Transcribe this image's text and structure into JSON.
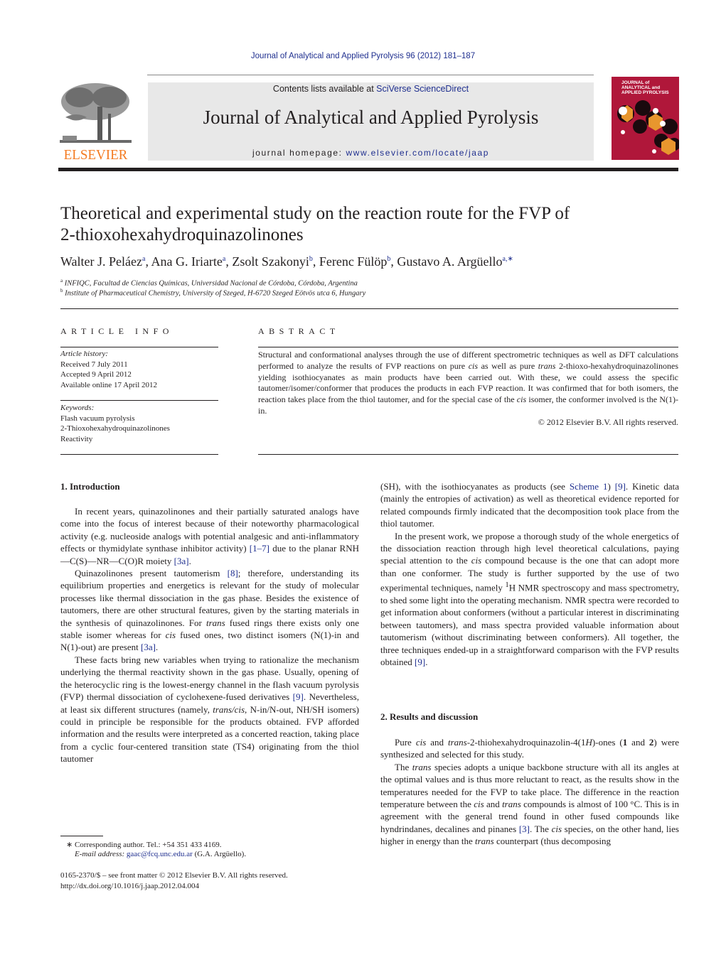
{
  "header": {
    "journal_reference": "Journal of Analytical and Applied Pyrolysis 96 (2012) 181–187",
    "contents_prefix": "Contents lists available at ",
    "contents_link": "SciVerse ScienceDirect",
    "journal_title": "Journal of Analytical and Applied Pyrolysis",
    "homepage_prefix": "journal homepage: ",
    "homepage_link": "www.elsevier.com/locate/jaap",
    "publisher_logo_text": "ELSEVIER",
    "cover_title_lines": [
      "JOURNAL of",
      "ANALYTICAL and",
      "APPLIED PYROLYSIS"
    ],
    "colors": {
      "link": "#1f2f8f",
      "elsevier_orange": "#f47a20",
      "banner_bg": "#e8e8e8",
      "cover_red": "#b0173a",
      "cover_orange": "#e8962e"
    }
  },
  "article": {
    "title_line1": "Theoretical and experimental study on the reaction route for the FVP of",
    "title_line2": "2-thioxohexahydroquinazolinones",
    "authors": [
      {
        "name": "Walter J. Peláez",
        "sup": "a"
      },
      {
        "name": "Ana G. Iriarte",
        "sup": "a"
      },
      {
        "name": "Zsolt Szakonyi",
        "sup": "b"
      },
      {
        "name": "Ferenc Fülöp",
        "sup": "b"
      },
      {
        "name": "Gustavo A. Argüello",
        "sup": "a,∗"
      }
    ],
    "affiliations": [
      {
        "mark": "a",
        "text": "INFIQC, Facultad de Ciencias Químicas, Universidad Nacional de Córdoba, Córdoba, Argentina"
      },
      {
        "mark": "b",
        "text": "Institute of Pharmaceutical Chemistry, University of Szeged, H-6720 Szeged Eötvös utca 6, Hungary"
      }
    ]
  },
  "article_info": {
    "heading": "ARTICLE INFO",
    "history_label": "Article history:",
    "history": [
      "Received 7 July 2011",
      "Accepted 9 April 2012",
      "Available online 17 April 2012"
    ],
    "keywords_label": "Keywords:",
    "keywords": [
      "Flash vacuum pyrolysis",
      "2-Thioxohexahydroquinazolinones",
      "Reactivity"
    ]
  },
  "abstract": {
    "heading": "ABSTRACT",
    "seg1": "Structural and conformational analyses through the use of different spectrometric techniques as well as DFT calculations performed to analyze the results of FVP reactions on pure ",
    "cis": "cis",
    "seg2": " as well as pure ",
    "trans": "trans",
    "seg3": " 2-thioxo-hexahydroquinazolinones yielding isothiocyanates as main products have been carried out. With these, we could assess the specific tautomer/isomer/conformer that produces the products in each FVP reaction. It was confirmed that for both isomers, the reaction takes place from the thiol tautomer, and for the special case of the ",
    "seg4": " isomer, the conformer involved is the N(1)-in.",
    "copyright": "© 2012 Elsevier B.V. All rights reserved."
  },
  "sections": {
    "intro_heading": "1.  Introduction",
    "intro_p1_a": "In recent years, quinazolinones and their partially saturated analogs have come into the focus of interest because of their noteworthy pharmacological activity (e.g. nucleoside analogs with potential analgesic and anti-inflammatory effects or thymidylate synthase inhibitor activity) ",
    "intro_p1_ref1": "[1–7]",
    "intro_p1_b": " due to the planar RNH—C(S)—NR—C(O)R moiety ",
    "intro_p1_ref2": "[3a]",
    "intro_p1_c": ".",
    "intro_p2_a": "Quinazolinones present tautomerism ",
    "intro_p2_ref1": "[8]",
    "intro_p2_b": "; therefore, understanding its equilibrium properties and energetics is relevant for the study of molecular processes like thermal dissociation in the gas phase. Besides the existence of tautomers, there are other structural features, given by the starting materials in the synthesis of quinazolinones. For ",
    "trans": "trans",
    "cis": "cis",
    "intro_p2_c": " fused rings there exists only one stable isomer whereas for ",
    "intro_p2_d": " fused ones, two distinct isomers (N(1)-in and N(1)-out) are present ",
    "intro_p2_ref2": "[3a]",
    "intro_p2_e": ".",
    "intro_p3_a": "These facts bring new variables when trying to rationalize the mechanism underlying the thermal reactivity shown in the gas phase. Usually, opening of the heterocyclic ring is the lowest-energy channel in the flash vacuum pyrolysis (FVP) thermal dissociation of cyclohexene-fused derivatives ",
    "intro_p3_ref1": "[9]",
    "intro_p3_b": ". Nevertheless, at least six different structures (namely, ",
    "intro_p3_transcis": "trans/cis",
    "intro_p3_c": ", N-in/N-out, NH/SH isomers) could in principle be responsible for the products obtained. FVP afforded information and the results were interpreted as a concerted reaction, taking place from a cyclic four-centered transition state (TS4) originating from the thiol tautomer",
    "right_p1_a": "(SH), with the isothiocyanates as products (see ",
    "right_p1_scheme": "Scheme 1",
    "right_p1_b": ") ",
    "right_p1_ref": "[9]",
    "right_p1_c": ". Kinetic data (mainly the entropies of activation) as well as theoretical evidence reported for related compounds firmly indicated that the decomposition took place from the thiol tautomer.",
    "right_p2_a": "In the present work, we propose a thorough study of the whole energetics of the dissociation reaction through high level theoretical calculations, paying special attention to the ",
    "right_p2_b": " compound because is the one that can adopt more than one conformer. The study is further supported by the use of two experimental techniques, namely ",
    "right_p2_sup": "1",
    "right_p2_c": "H NMR spectroscopy and mass spectrometry, to shed some light into the operating mechanism. NMR spectra were recorded to get information about conformers (without a particular interest in discriminating between tautomers), and mass spectra provided valuable information about tautomerism (without discriminating between conformers). All together, the three techniques ended-up in a straightforward comparison with the FVP results obtained ",
    "right_p2_ref": "[9]",
    "right_p2_d": ".",
    "results_heading": "2.  Results and discussion",
    "res_p1_a": "Pure ",
    "res_p1_b": " and ",
    "res_p1_c": "-2-thiohexahydroquinazolin-4(1",
    "res_p1_H": "H",
    "res_p1_d": ")-ones (",
    "res_p1_one": "1",
    "res_p1_e": " and ",
    "res_p1_two": "2",
    "res_p1_f": ") were synthesized and selected for this study.",
    "res_p2_a": "The ",
    "res_p2_b": " species adopts a unique backbone structure with all its angles at the optimal values and is thus more reluctant to react, as the results show in the temperatures needed for the FVP to take place. The difference in the reaction temperature between the ",
    "res_p2_c": " and ",
    "res_p2_d": " compounds is almost of 100 °C. This is in agreement with the general trend found in other fused compounds like hyndrindanes, decalines and pinanes ",
    "res_p2_ref": "[3]",
    "res_p2_e": ". The ",
    "res_p2_f": " species, on the other hand, lies higher in energy than the ",
    "res_p2_g": " counterpart (thus decomposing"
  },
  "footnotes": {
    "corresponding": "∗  Corresponding author. Tel.: +54 351 433 4169.",
    "email_label": "E-mail address: ",
    "email": "gaac@fcq.unc.edu.ar",
    "email_suffix": " (G.A. Argüello).",
    "issn_line": "0165-2370/$ – see front matter © 2012 Elsevier B.V. All rights reserved.",
    "doi": "http://dx.doi.org/10.1016/j.jaap.2012.04.004"
  }
}
